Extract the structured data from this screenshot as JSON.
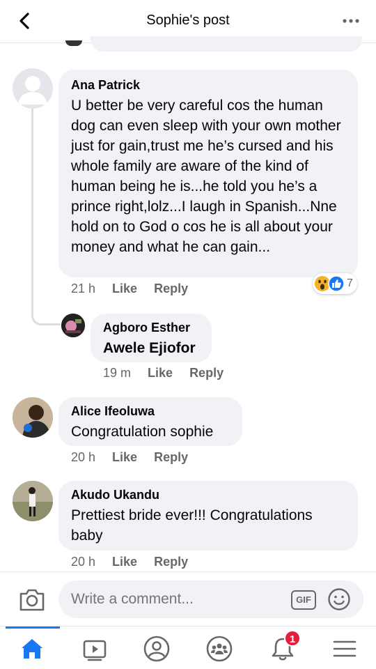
{
  "header": {
    "title": "Sophie's post",
    "back_icon": "chevron-left-icon",
    "more_icon": "more-horizontal-icon"
  },
  "comments": [
    {
      "author": "Ana Patrick",
      "text": "U better be very careful cos the human dog can even sleep with your own mother just for gain,trust me he’s cursed and his whole family are aware of the kind of human being he is...he told you he’s a prince right,lolz...I laugh in Spanish...Nne hold on to God o cos he is all about your money and what he can gain...",
      "time": "21 h",
      "like": "Like",
      "reply": "Reply",
      "reactions": {
        "types": [
          "wow",
          "like"
        ],
        "count": "7"
      },
      "replies": [
        {
          "author": "Agboro Esther",
          "text": "Awele Ejiofor",
          "time": "19 m",
          "like": "Like",
          "reply": "Reply"
        }
      ]
    },
    {
      "author": "Alice Ifeoluwa",
      "text": "Congratulation sophie",
      "time": "20 h",
      "like": "Like",
      "reply": "Reply"
    },
    {
      "author": "Akudo Ukandu",
      "text": "Prettiest bride ever!!!  Congratulations baby",
      "time": "20 h",
      "like": "Like",
      "reply": "Reply"
    }
  ],
  "composer": {
    "placeholder": "Write a comment...",
    "gif_label": "GIF"
  },
  "bottom_nav": {
    "items": [
      "home-icon",
      "watch-icon",
      "profile-icon",
      "groups-icon",
      "notifications-icon",
      "menu-icon"
    ],
    "notifications_badge": "1",
    "active_color": "#1877f2"
  },
  "colors": {
    "bubble": "#f0f2f5",
    "meta_text": "#65676b",
    "badge": "#e41e3f"
  }
}
